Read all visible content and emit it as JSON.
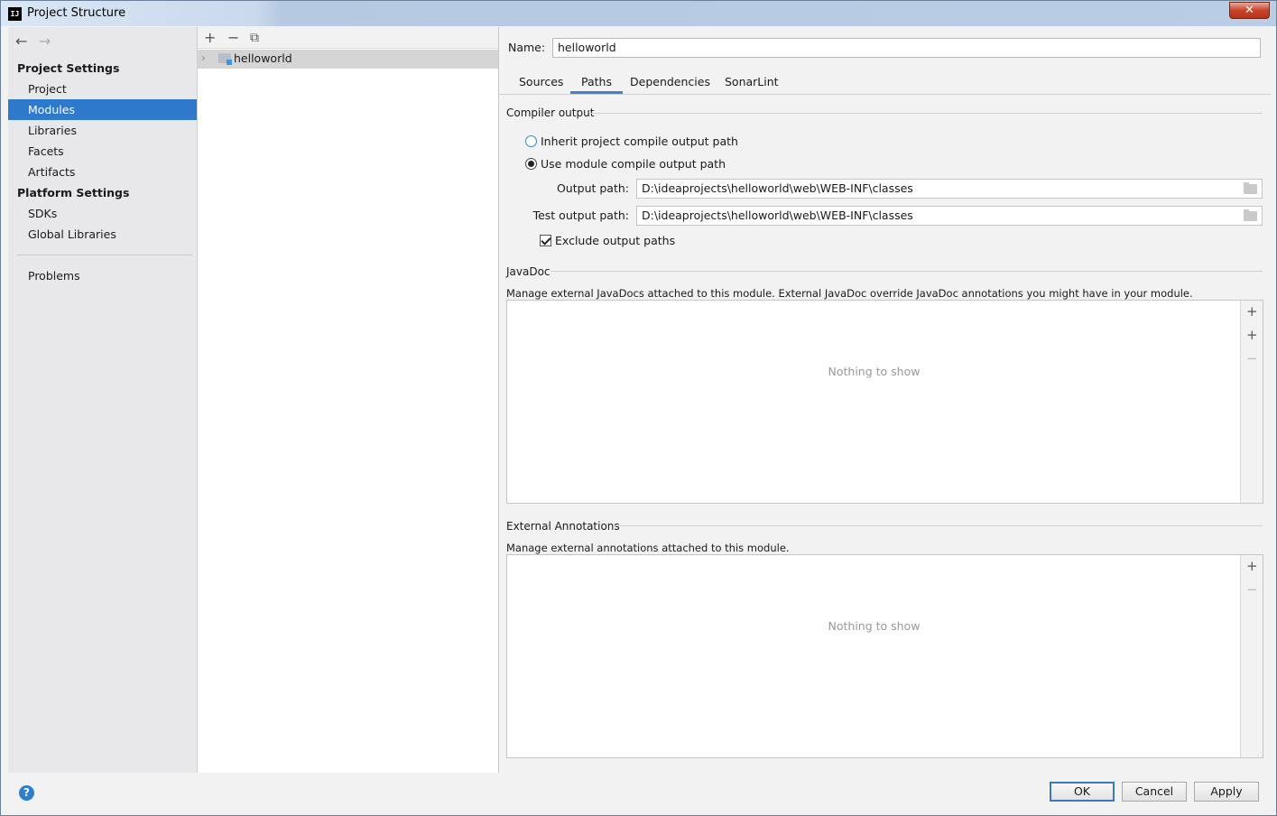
{
  "window": {
    "title": "Project Structure",
    "app_icon_text": "IJ",
    "close_glyph": "✕"
  },
  "sidebar": {
    "back_glyph": "←",
    "forward_glyph": "→",
    "project_settings_heading": "Project Settings",
    "platform_settings_heading": "Platform Settings",
    "items": [
      {
        "label": "Project"
      },
      {
        "label": "Modules",
        "selected": true
      },
      {
        "label": "Libraries"
      },
      {
        "label": "Facets"
      },
      {
        "label": "Artifacts"
      },
      {
        "label": "SDKs"
      },
      {
        "label": "Global Libraries"
      },
      {
        "label": "Problems"
      }
    ]
  },
  "module_tree": {
    "add_glyph": "+",
    "remove_glyph": "−",
    "copy_glyph": "⧉",
    "chevron_glyph": "›",
    "modules": [
      {
        "name": "helloworld"
      }
    ]
  },
  "editor": {
    "name_label": "Name:",
    "name_value": "helloworld",
    "tabs": [
      {
        "label": "Sources"
      },
      {
        "label": "Paths",
        "active": true
      },
      {
        "label": "Dependencies"
      },
      {
        "label": "SonarLint"
      }
    ],
    "compiler_output": {
      "title": "Compiler output",
      "inherit_label": "Inherit project compile output path",
      "use_module_label": "Use module compile output path",
      "selected_option": "use_module",
      "output_path_label": "Output path:",
      "output_path_value": "D:\\ideaprojects\\helloworld\\web\\WEB-INF\\classes",
      "test_output_path_label": "Test output path:",
      "test_output_path_value": "D:\\ideaprojects\\helloworld\\web\\WEB-INF\\classes",
      "exclude_label": "Exclude output paths",
      "exclude_checked": true
    },
    "javadoc": {
      "title": "JavaDoc",
      "description": "Manage external JavaDocs attached to this module. External JavaDoc override JavaDoc annotations you might have in your module.",
      "empty_text": "Nothing to show",
      "add_glyph": "+",
      "add_url_glyph": "+",
      "remove_glyph": "−"
    },
    "external_annotations": {
      "title": "External Annotations",
      "description": "Manage external annotations attached to this module.",
      "empty_text": "Nothing to show",
      "add_glyph": "+",
      "remove_glyph": "−"
    }
  },
  "footer": {
    "help_glyph": "?",
    "ok_label": "OK",
    "cancel_label": "Cancel",
    "apply_label": "Apply"
  },
  "colors": {
    "selection": "#2f79cc",
    "accent_tab": "#4083c9"
  }
}
